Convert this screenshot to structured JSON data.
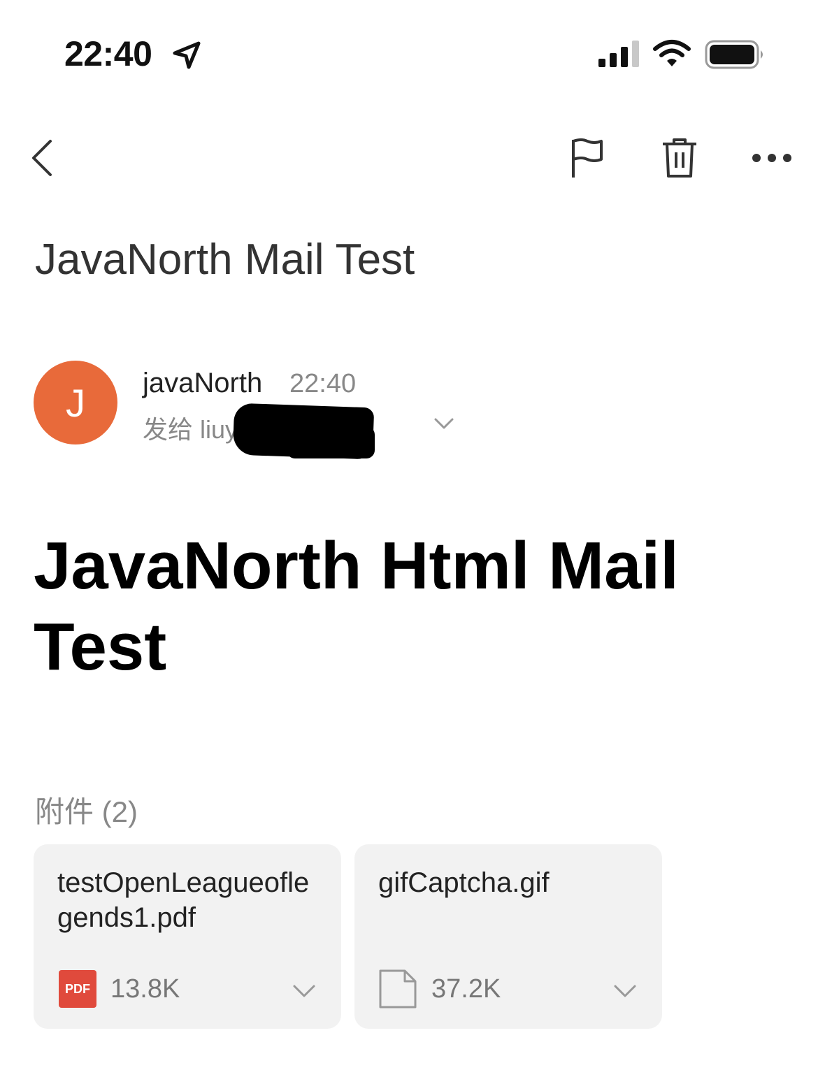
{
  "status_bar": {
    "time": "22:40"
  },
  "icons": {
    "location": "location-arrow-icon",
    "signal": "cellular-signal-icon",
    "wifi": "wifi-icon",
    "battery": "battery-icon",
    "back": "chevron-left-icon",
    "flag": "flag-icon",
    "trash": "trash-icon",
    "more": "more-dots-icon"
  },
  "email": {
    "subject": "JavaNorth Mail Test",
    "sender": {
      "avatar_letter": "J",
      "avatar_color": "#e86a3a",
      "name": "javaNorth",
      "time": "22:40",
      "recipients": "发给 liuy                     09,我"
    },
    "body_heading": "JavaNorth Html Mail Test"
  },
  "attachments": {
    "label": "附件 (2)",
    "items": [
      {
        "name": "testOpenLeagueoflegends1.pdf",
        "type_badge": "PDF",
        "size": "13.8K"
      },
      {
        "name": "gifCaptcha.gif",
        "size": "37.2K"
      }
    ]
  },
  "colors": {
    "pdf_badge": "#e04a3c",
    "card_bg": "#f2f2f2"
  }
}
